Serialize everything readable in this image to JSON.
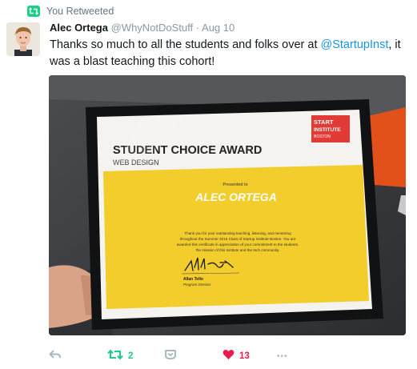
{
  "retweet_header": {
    "label": "You Retweeted"
  },
  "tweet": {
    "author_name": "Alec Ortega",
    "handle": "@WhyNotDoStuff",
    "separator": "·",
    "date": "Aug 10",
    "text_before": "Thanks so much to all the students and folks over at ",
    "mention": "@StartupInst",
    "text_after": ", it was a blast teaching this cohort!"
  },
  "certificate": {
    "logo": {
      "line1": "START",
      "line2": "INSTITUTE",
      "line3": "BOSTON"
    },
    "title": "STUDENT CHOICE AWARD",
    "subtitle": "WEB DESIGN",
    "presented_to": "Presented to",
    "recipient": "ALEC ORTEGA",
    "body_line1": "Thank you for your outstanding teaching, listening, and mentoring",
    "body_line2": "throughout the Summer 2016 Class of Startup Institute Boston. You are",
    "body_line3": "awarded this certificate in appreciation of your commitment to the students,",
    "body_line4": "the mission of this institute and the tech community.",
    "signer_name": "Allan Tello",
    "signer_title": "Program Director"
  },
  "actions": {
    "retweet_count": "2",
    "like_count": "13",
    "more_label": "•••"
  },
  "colors": {
    "retweet_green": "#19cf86",
    "like_red": "#e81c4f",
    "link_blue": "#1b95e0",
    "certificate_yellow": "#f2cd2c",
    "brand_red": "#e23a34"
  },
  "icons": [
    "retweet-icon",
    "reply-icon",
    "dm-icon",
    "heart-icon",
    "more-icon"
  ]
}
